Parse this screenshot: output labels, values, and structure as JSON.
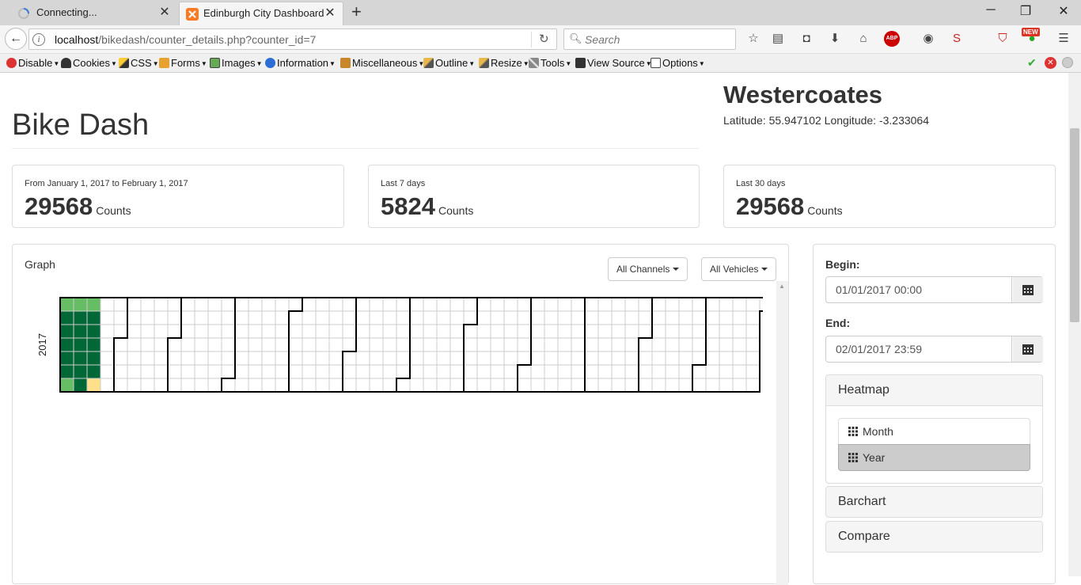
{
  "browser": {
    "tabs": [
      {
        "label": "Connecting...",
        "active": false
      },
      {
        "label": "Edinburgh City Dashboard",
        "active": true
      }
    ],
    "url_host": "localhost",
    "url_path": "/bikedash/counter_details.php?counter_id=7",
    "search_placeholder": "Search",
    "new_badge": "NEW",
    "abp_label": "ABP",
    "toolbar": {
      "disable": "Disable",
      "cookies": "Cookies",
      "css": "CSS",
      "forms": "Forms",
      "images": "Images",
      "information": "Information",
      "miscellaneous": "Miscellaneous",
      "outline": "Outline",
      "resize": "Resize",
      "tools": "Tools",
      "view_source": "View Source",
      "options": "Options"
    }
  },
  "page": {
    "title": "Bike Dash",
    "location": {
      "name": "Westercoates",
      "coords": "Latitude: 55.947102 Longitude: -3.233064"
    },
    "stats": [
      {
        "label": "From January 1, 2017 to February 1, 2017",
        "value": "29568",
        "unit": "Counts"
      },
      {
        "label": "Last 7 days",
        "value": "5824",
        "unit": "Counts"
      },
      {
        "label": "Last 30 days",
        "value": "29568",
        "unit": "Counts"
      }
    ],
    "graph": {
      "title": "Graph",
      "channels_label": "All Channels",
      "vehicles_label": "All Vehicles"
    },
    "controls": {
      "begin_label": "Begin:",
      "begin_value": "01/01/2017 00:00",
      "end_label": "End:",
      "end_value": "02/01/2017 23:59",
      "heatmap_label": "Heatmap",
      "heatmap_options": [
        {
          "label": "Month",
          "active": false
        },
        {
          "label": "Year",
          "active": true
        }
      ],
      "barchart_label": "Barchart",
      "compare_label": "Compare"
    }
  },
  "chart_data": {
    "type": "heatmap",
    "year_label": "2017",
    "layout": "calendar-year (weeks x weekdays)",
    "weeks": 53,
    "days_per_week": 7,
    "colors": {
      "none": "#ffffff",
      "low": "#fee08b",
      "medium": "#66bd63",
      "high": "#006837"
    },
    "filled_cells": [
      {
        "week": 0,
        "day": 0,
        "level": "medium"
      },
      {
        "week": 0,
        "day": 1,
        "level": "high"
      },
      {
        "week": 0,
        "day": 2,
        "level": "high"
      },
      {
        "week": 0,
        "day": 3,
        "level": "high"
      },
      {
        "week": 0,
        "day": 4,
        "level": "high"
      },
      {
        "week": 0,
        "day": 5,
        "level": "high"
      },
      {
        "week": 0,
        "day": 6,
        "level": "medium"
      },
      {
        "week": 1,
        "day": 0,
        "level": "medium"
      },
      {
        "week": 1,
        "day": 1,
        "level": "high"
      },
      {
        "week": 1,
        "day": 2,
        "level": "high"
      },
      {
        "week": 1,
        "day": 3,
        "level": "high"
      },
      {
        "week": 1,
        "day": 4,
        "level": "high"
      },
      {
        "week": 1,
        "day": 5,
        "level": "high"
      },
      {
        "week": 1,
        "day": 6,
        "level": "high"
      },
      {
        "week": 2,
        "day": 0,
        "level": "medium"
      },
      {
        "week": 2,
        "day": 1,
        "level": "high"
      },
      {
        "week": 2,
        "day": 2,
        "level": "high"
      },
      {
        "week": 2,
        "day": 3,
        "level": "high"
      },
      {
        "week": 2,
        "day": 4,
        "level": "high"
      },
      {
        "week": 2,
        "day": 5,
        "level": "high"
      },
      {
        "week": 2,
        "day": 6,
        "level": "low"
      }
    ],
    "month_start_days": [
      0,
      31,
      59,
      90,
      120,
      151,
      181,
      212,
      243,
      273,
      304,
      334
    ],
    "year_start_weekday": 0,
    "total_days": 365
  }
}
